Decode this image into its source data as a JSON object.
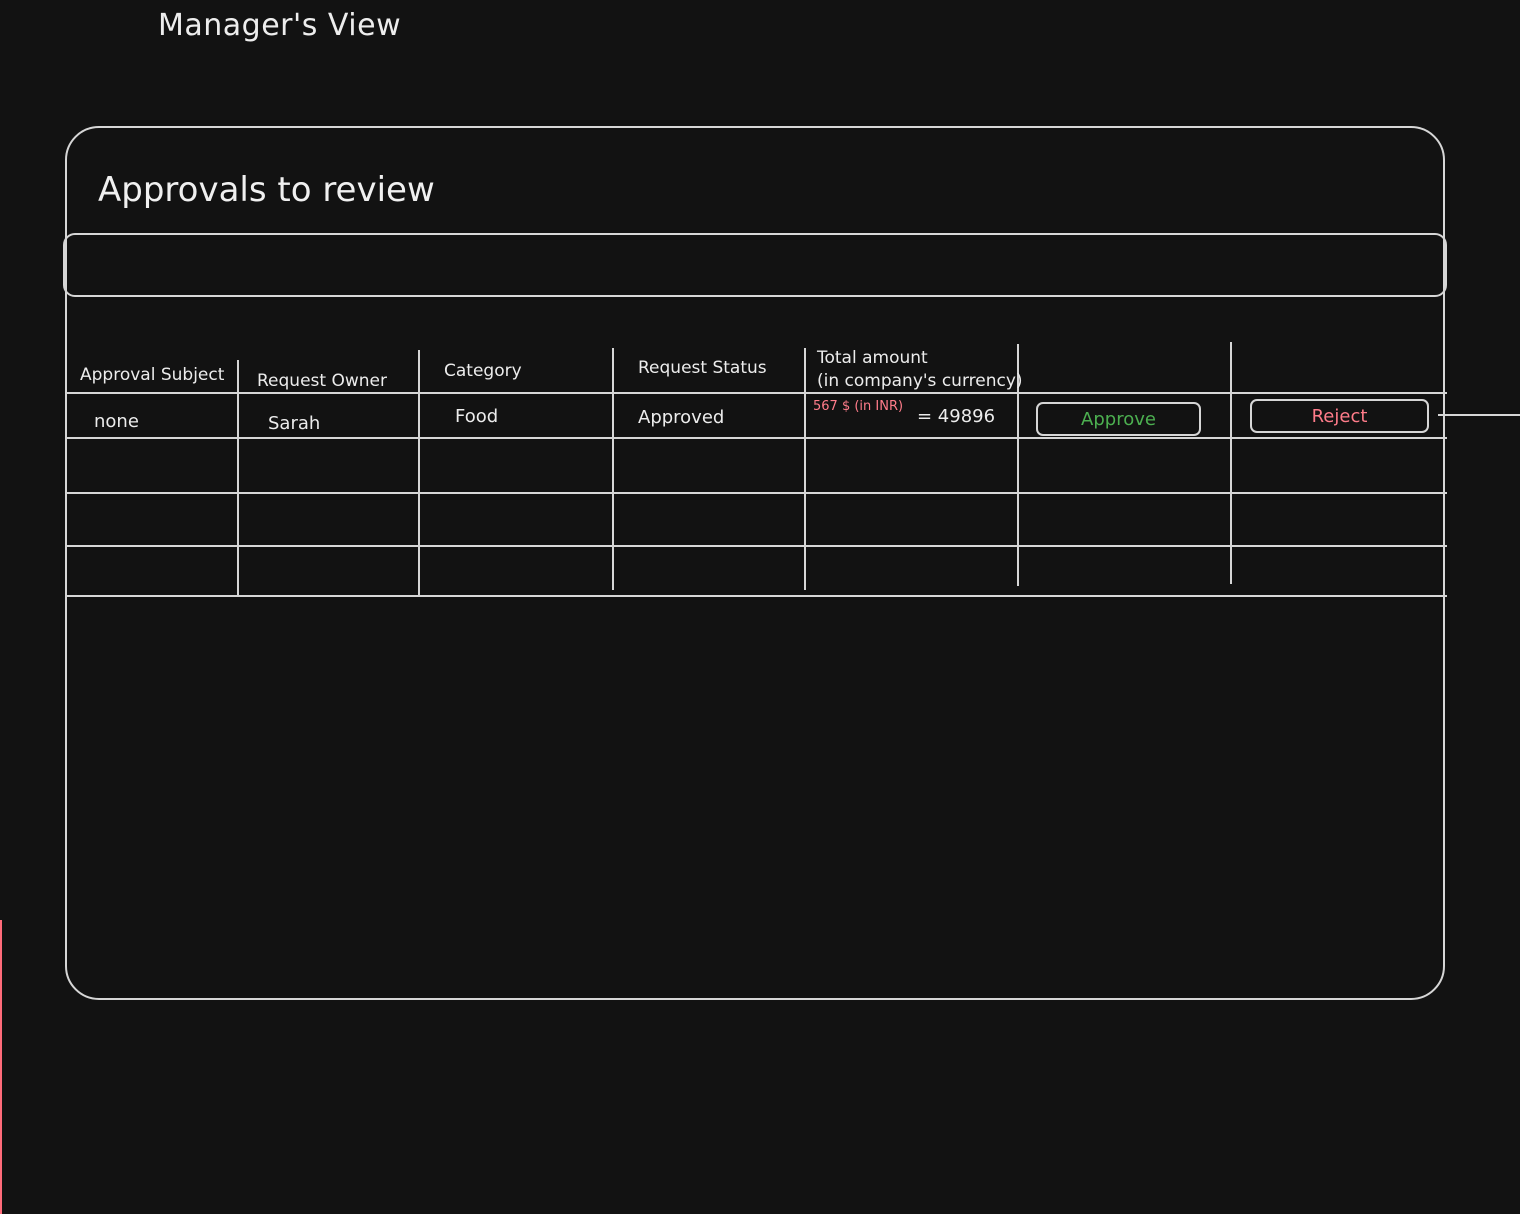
{
  "page": {
    "title": "Manager's View"
  },
  "panel": {
    "title": "Approvals to review",
    "search_value": ""
  },
  "table": {
    "columns": [
      "Approval Subject",
      "Request Owner",
      "Category",
      "Request Status",
      "Total amount",
      "(in company's currency)"
    ],
    "rows": [
      {
        "subject": "none",
        "owner": "Sarah",
        "category": "Food",
        "status": "Approved",
        "amount_note": "567 $ (in INR)",
        "amount_value": "= 49896",
        "approve_label": "Approve",
        "reject_label": "Reject"
      }
    ]
  },
  "colors": {
    "background": "#121212",
    "stroke": "#d6d6d6",
    "approve": "#4caf50",
    "reject": "#ff7c8a"
  }
}
